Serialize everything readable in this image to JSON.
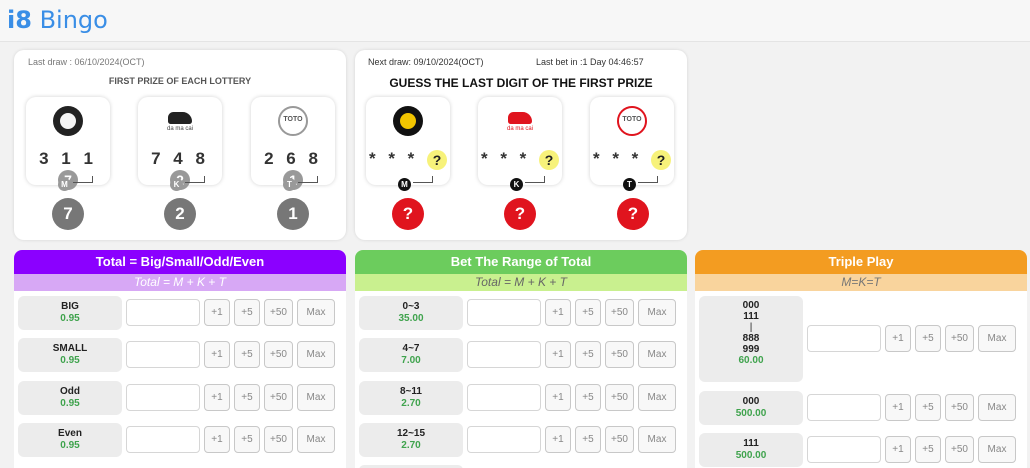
{
  "app": {
    "logo_bold": "i8",
    "logo_rest": " Bingo"
  },
  "results": {
    "last_draw": "Last draw : 06/10/2024(OCT)",
    "subtitle": "FIRST PRIZE OF EACH LOTTERY",
    "lotteries": [
      {
        "code": "M",
        "digits": "3 1 1",
        "last": "7",
        "result": "7"
      },
      {
        "code": "K",
        "digits": "7 4 8",
        "last": "2",
        "result": "2",
        "brand": "da ma cai"
      },
      {
        "code": "T",
        "digits": "2 6 8",
        "last": "1",
        "result": "1",
        "brand": "TOTO"
      }
    ]
  },
  "guess": {
    "next_draw": "Next draw: 09/10/2024(OCT)",
    "last_bet": "Last bet in :1 Day 04:46:57",
    "title": "GUESS THE LAST DIGIT OF THE FIRST PRIZE",
    "tiles": [
      {
        "code": "M",
        "masked": "* * *",
        "q": "?",
        "result": "?"
      },
      {
        "code": "K",
        "masked": "* * *",
        "q": "?",
        "result": "?",
        "brand": "da ma cai"
      },
      {
        "code": "T",
        "masked": "* * *",
        "q": "?",
        "result": "?",
        "brand": "TOTO"
      }
    ]
  },
  "buttons": {
    "plus1": "+1",
    "plus5": "+5",
    "plus50": "+50",
    "max": "Max"
  },
  "panels": {
    "bso": {
      "title": "Total = Big/Small/Odd/Even",
      "subtitle": "Total = M + K + T",
      "color": "#8b00ff",
      "rows": [
        {
          "name": "BIG",
          "odds": "0.95"
        },
        {
          "name": "SMALL",
          "odds": "0.95"
        },
        {
          "name": "Odd",
          "odds": "0.95"
        },
        {
          "name": "Even",
          "odds": "0.95"
        }
      ]
    },
    "range": {
      "title": "Bet The Range of Total",
      "subtitle": "Total = M + K + T",
      "color": "#6ccc5d",
      "rows": [
        {
          "name": "0~3",
          "odds": "35.00"
        },
        {
          "name": "4~7",
          "odds": "7.00"
        },
        {
          "name": "8~11",
          "odds": "2.70"
        },
        {
          "name": "12~15",
          "odds": "2.70"
        }
      ]
    },
    "triple": {
      "title": "Triple Play",
      "subtitle": "M=K=T",
      "color": "#f39c21",
      "first": {
        "l1": "000",
        "l2": "111",
        "l3": "|",
        "l4": "888",
        "l5": "999",
        "odds": "60.00"
      },
      "rows": [
        {
          "name": "000",
          "odds": "500.00"
        },
        {
          "name": "111",
          "odds": "500.00"
        }
      ]
    }
  },
  "colors": {
    "accent": "#3a8ee6",
    "odds_green": "#3fa34d",
    "alert_red": "#e0141e",
    "question_yellow": "#f7f27a"
  },
  "icons": [
    "magnum-logo-icon",
    "damacai-horse-icon",
    "toto-logo-icon"
  ]
}
